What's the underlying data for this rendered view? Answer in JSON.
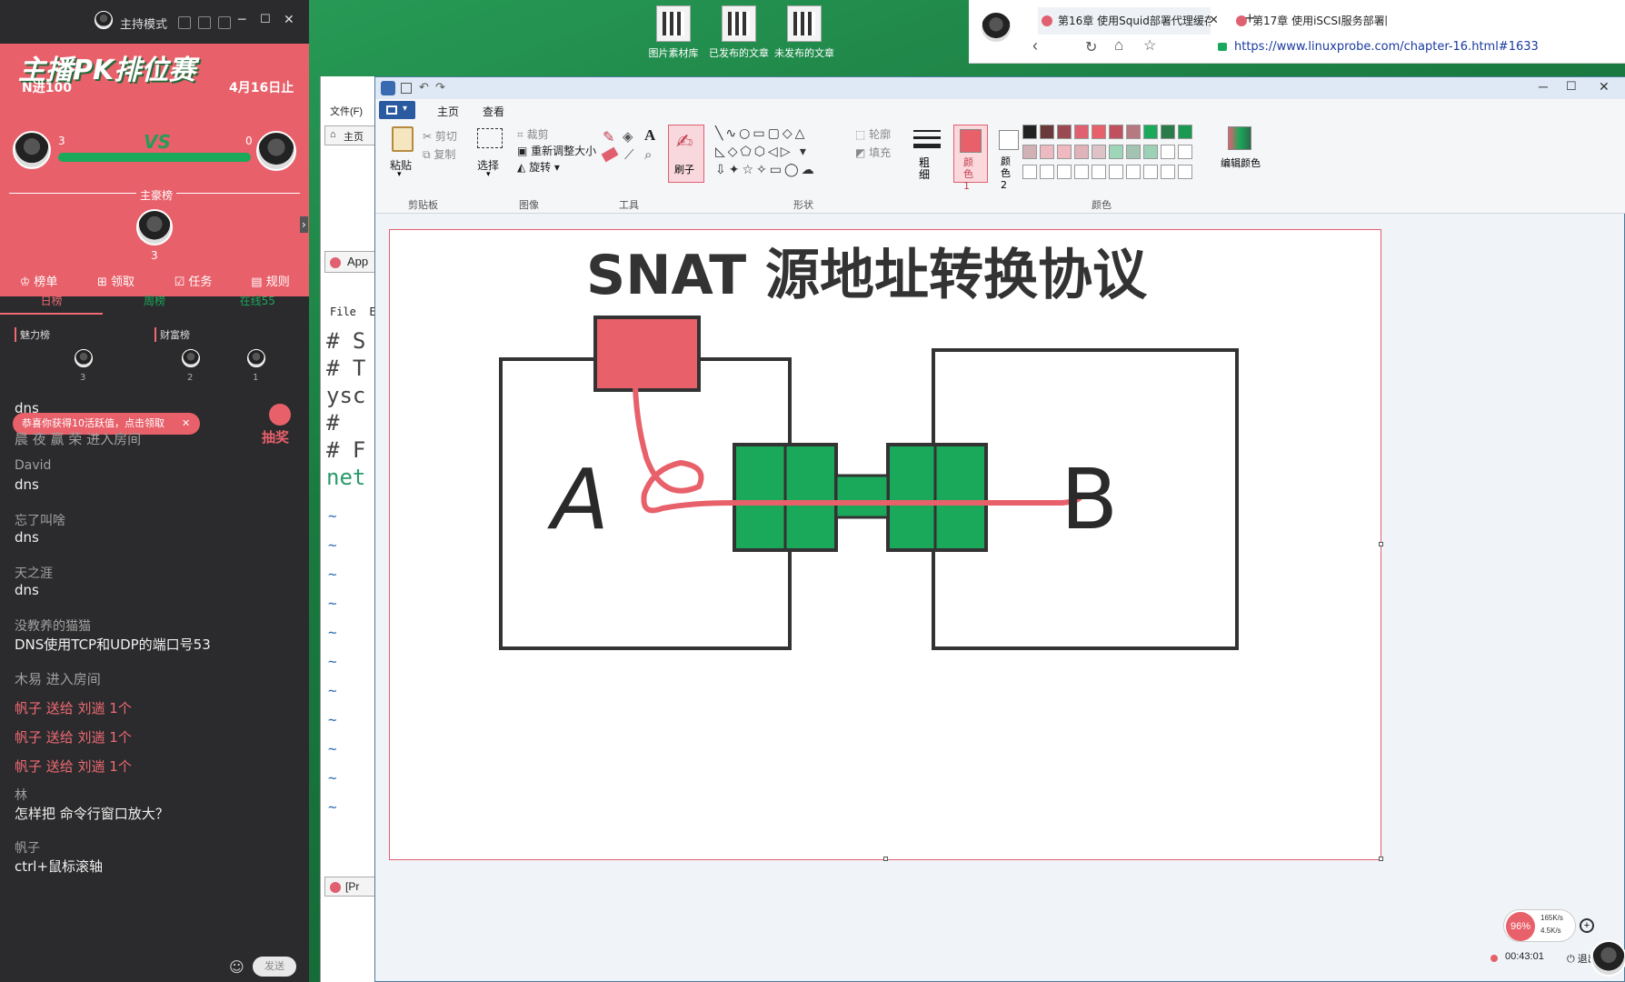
{
  "desktop": {
    "icons": [
      {
        "label": "图片素材库"
      },
      {
        "label": "已发布的文章"
      },
      {
        "label": "未发布的文章"
      }
    ]
  },
  "stream": {
    "mode_title": "主持模式",
    "banner_title": "主播PK排位赛",
    "rank_label": "N进100",
    "date_label": "4月16日止",
    "score_left": "3",
    "vs_label": "VS",
    "score_right": "0",
    "host_list_label": "主豪榜",
    "host_count": "3",
    "nav": [
      {
        "label": "榜单"
      },
      {
        "label": "领取"
      },
      {
        "label": "任务"
      },
      {
        "label": "规则"
      }
    ],
    "tabs": [
      {
        "label": "日榜"
      },
      {
        "label": "周榜"
      },
      {
        "label": "在线55"
      }
    ],
    "charm_label": "魅力榜",
    "wealth_label": "财富榜",
    "ranks": [
      "3",
      "2",
      "1"
    ],
    "toast": "恭喜你获得10活跃值，点击领取",
    "lottery": "抽奖",
    "chat": [
      {
        "name": "",
        "text": "dns"
      },
      {
        "name": "",
        "text": "晨 夜 赢 荣 进入房间",
        "system": true
      },
      {
        "name": "David",
        "text": "dns"
      },
      {
        "name": "忘了叫啥",
        "text": "dns"
      },
      {
        "name": "天之涯",
        "text": "dns"
      },
      {
        "name": "没教养的猫猫",
        "text": "DNS使用TCP和UDP的端口号53"
      },
      {
        "name": "",
        "text": "木易 进入房间",
        "system": true
      },
      {
        "name": "",
        "text": "帆子 送给 刘遄 1个",
        "gift": true
      },
      {
        "name": "",
        "text": "帆子 送给 刘遄 1个",
        "gift": true
      },
      {
        "name": "",
        "text": "帆子 送给 刘遄 1个",
        "gift": true
      },
      {
        "name": "林",
        "text": "怎样把 命令行窗口放大？"
      },
      {
        "name": "帆子",
        "text": "ctrl+鼠标滚轴"
      }
    ],
    "send_label": "发送"
  },
  "browser": {
    "tabs": [
      {
        "label": "第16章 使用Squid部署代理缓存"
      },
      {
        "label": "第17章 使用iSCSI服务部署网络"
      }
    ],
    "new_tab": "+",
    "url": "https://www.linuxprobe.com/chapter-16.html#1633"
  },
  "editor": {
    "menu_file": "文件(F)",
    "home_tab": "主页",
    "app_tab": "App",
    "menu_items": [
      "File",
      "E"
    ],
    "lines": [
      "# S",
      "# T",
      "ysc",
      "#",
      "# F",
      "net"
    ],
    "tilde_count": 11,
    "bottom_tab": "[Pr"
  },
  "paint": {
    "ribbon_tabs": [
      {
        "label": "主页"
      },
      {
        "label": "查看"
      }
    ],
    "groups": {
      "clipboard": {
        "label": "剪贴板",
        "paste": "粘贴",
        "cut": "剪切",
        "copy": "复制"
      },
      "image": {
        "label": "图像",
        "select": "选择",
        "crop": "裁剪",
        "resize": "重新调整大小",
        "rotate": "旋转"
      },
      "tools": {
        "label": "工具"
      },
      "brush": {
        "label": "刷子"
      },
      "shapes": {
        "label": "形状",
        "outline": "轮廓",
        "fill": "填充"
      },
      "size": {
        "label": "粗细"
      },
      "color1": {
        "label": "颜色 1"
      },
      "color2": {
        "label": "颜色 2"
      },
      "colors": {
        "label": "颜色",
        "edit": "编辑颜色"
      }
    },
    "palette": [
      "#222222",
      "#6a3a3a",
      "#9a4a50",
      "#e06070",
      "#e8606a",
      "#c05060",
      "#b87880",
      "#1aa85a",
      "#2a7a4a",
      "#1a9a50",
      "#3a6a4a",
      "#7a3a4a"
    ],
    "canvas": {
      "title": "SNAT 源地址转换协议",
      "label_a": "A",
      "label_b": "B"
    }
  },
  "tray": {
    "percent": "96%",
    "up_speed": "165K/s",
    "down_speed": "4.5K/s",
    "timer": "00:43:01",
    "exit_label": "退出"
  }
}
